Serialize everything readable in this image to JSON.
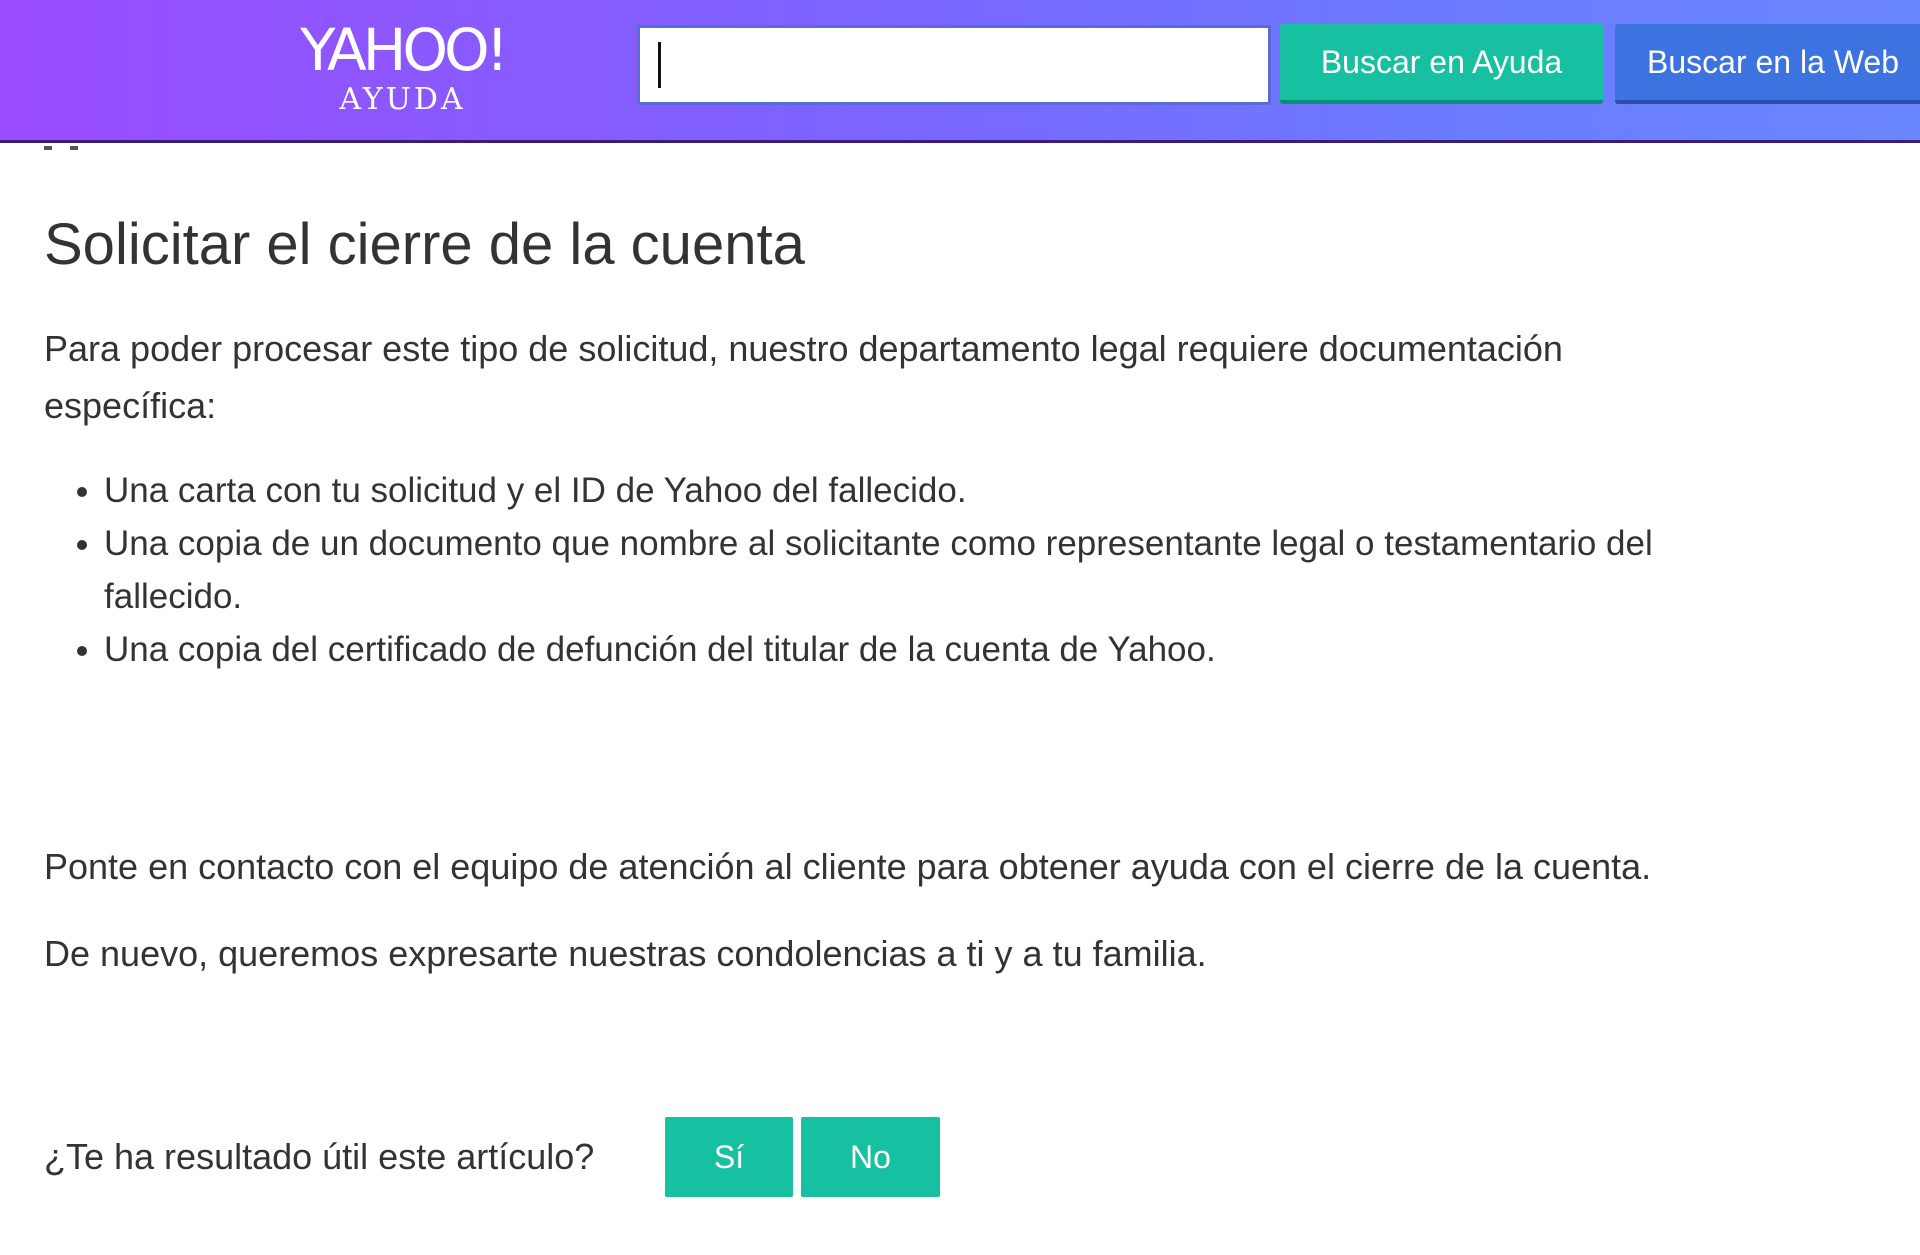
{
  "header": {
    "logo_main": "YAHOO!",
    "logo_sub": "AYUDA",
    "search": {
      "value": "",
      "placeholder": ""
    },
    "search_help_label": "Buscar en Ayuda",
    "search_web_label": "Buscar en la Web"
  },
  "article": {
    "title": "Solicitar el cierre de la cuenta",
    "intro": "Para poder procesar este tipo de solicitud, nuestro departamento legal requiere documentación específica:",
    "requirements": [
      "Una carta con tu solicitud y el ID de Yahoo del fallecido.",
      "Una copia de un documento que nombre al solicitante como representante legal o testamentario del fallecido.",
      "Una copia del certificado de defunción del titular de la cuenta de Yahoo."
    ],
    "contact": "Ponte en contacto con el equipo de atención al cliente para obtener ayuda con el cierre de la cuenta.",
    "condolences": "De nuevo, queremos expresarte nuestras condolencias a ti y a tu familia."
  },
  "feedback": {
    "question": "¿Te ha resultado útil este artículo?",
    "yes_label": "Sí",
    "no_label": "No"
  },
  "colors": {
    "header_gradient_start": "#9a4cff",
    "header_gradient_end": "#6a86ff",
    "teal_button": "#16c0a1",
    "blue_button": "#3d73e0",
    "text": "#333333"
  }
}
